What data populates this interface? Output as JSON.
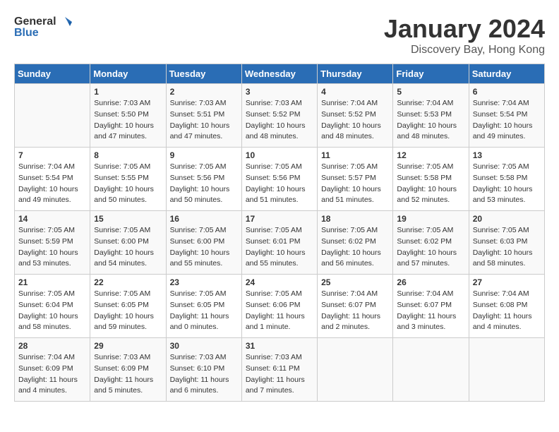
{
  "header": {
    "logo_line1": "General",
    "logo_line2": "Blue",
    "month_title": "January 2024",
    "location": "Discovery Bay, Hong Kong"
  },
  "days_of_week": [
    "Sunday",
    "Monday",
    "Tuesday",
    "Wednesday",
    "Thursday",
    "Friday",
    "Saturday"
  ],
  "weeks": [
    [
      {
        "day": "",
        "sunrise": "",
        "sunset": "",
        "daylight": ""
      },
      {
        "day": "1",
        "sunrise": "Sunrise: 7:03 AM",
        "sunset": "Sunset: 5:50 PM",
        "daylight": "Daylight: 10 hours and 47 minutes."
      },
      {
        "day": "2",
        "sunrise": "Sunrise: 7:03 AM",
        "sunset": "Sunset: 5:51 PM",
        "daylight": "Daylight: 10 hours and 47 minutes."
      },
      {
        "day": "3",
        "sunrise": "Sunrise: 7:03 AM",
        "sunset": "Sunset: 5:52 PM",
        "daylight": "Daylight: 10 hours and 48 minutes."
      },
      {
        "day": "4",
        "sunrise": "Sunrise: 7:04 AM",
        "sunset": "Sunset: 5:52 PM",
        "daylight": "Daylight: 10 hours and 48 minutes."
      },
      {
        "day": "5",
        "sunrise": "Sunrise: 7:04 AM",
        "sunset": "Sunset: 5:53 PM",
        "daylight": "Daylight: 10 hours and 48 minutes."
      },
      {
        "day": "6",
        "sunrise": "Sunrise: 7:04 AM",
        "sunset": "Sunset: 5:54 PM",
        "daylight": "Daylight: 10 hours and 49 minutes."
      }
    ],
    [
      {
        "day": "7",
        "sunrise": "Sunrise: 7:04 AM",
        "sunset": "Sunset: 5:54 PM",
        "daylight": "Daylight: 10 hours and 49 minutes."
      },
      {
        "day": "8",
        "sunrise": "Sunrise: 7:05 AM",
        "sunset": "Sunset: 5:55 PM",
        "daylight": "Daylight: 10 hours and 50 minutes."
      },
      {
        "day": "9",
        "sunrise": "Sunrise: 7:05 AM",
        "sunset": "Sunset: 5:56 PM",
        "daylight": "Daylight: 10 hours and 50 minutes."
      },
      {
        "day": "10",
        "sunrise": "Sunrise: 7:05 AM",
        "sunset": "Sunset: 5:56 PM",
        "daylight": "Daylight: 10 hours and 51 minutes."
      },
      {
        "day": "11",
        "sunrise": "Sunrise: 7:05 AM",
        "sunset": "Sunset: 5:57 PM",
        "daylight": "Daylight: 10 hours and 51 minutes."
      },
      {
        "day": "12",
        "sunrise": "Sunrise: 7:05 AM",
        "sunset": "Sunset: 5:58 PM",
        "daylight": "Daylight: 10 hours and 52 minutes."
      },
      {
        "day": "13",
        "sunrise": "Sunrise: 7:05 AM",
        "sunset": "Sunset: 5:58 PM",
        "daylight": "Daylight: 10 hours and 53 minutes."
      }
    ],
    [
      {
        "day": "14",
        "sunrise": "Sunrise: 7:05 AM",
        "sunset": "Sunset: 5:59 PM",
        "daylight": "Daylight: 10 hours and 53 minutes."
      },
      {
        "day": "15",
        "sunrise": "Sunrise: 7:05 AM",
        "sunset": "Sunset: 6:00 PM",
        "daylight": "Daylight: 10 hours and 54 minutes."
      },
      {
        "day": "16",
        "sunrise": "Sunrise: 7:05 AM",
        "sunset": "Sunset: 6:00 PM",
        "daylight": "Daylight: 10 hours and 55 minutes."
      },
      {
        "day": "17",
        "sunrise": "Sunrise: 7:05 AM",
        "sunset": "Sunset: 6:01 PM",
        "daylight": "Daylight: 10 hours and 55 minutes."
      },
      {
        "day": "18",
        "sunrise": "Sunrise: 7:05 AM",
        "sunset": "Sunset: 6:02 PM",
        "daylight": "Daylight: 10 hours and 56 minutes."
      },
      {
        "day": "19",
        "sunrise": "Sunrise: 7:05 AM",
        "sunset": "Sunset: 6:02 PM",
        "daylight": "Daylight: 10 hours and 57 minutes."
      },
      {
        "day": "20",
        "sunrise": "Sunrise: 7:05 AM",
        "sunset": "Sunset: 6:03 PM",
        "daylight": "Daylight: 10 hours and 58 minutes."
      }
    ],
    [
      {
        "day": "21",
        "sunrise": "Sunrise: 7:05 AM",
        "sunset": "Sunset: 6:04 PM",
        "daylight": "Daylight: 10 hours and 58 minutes."
      },
      {
        "day": "22",
        "sunrise": "Sunrise: 7:05 AM",
        "sunset": "Sunset: 6:05 PM",
        "daylight": "Daylight: 10 hours and 59 minutes."
      },
      {
        "day": "23",
        "sunrise": "Sunrise: 7:05 AM",
        "sunset": "Sunset: 6:05 PM",
        "daylight": "Daylight: 11 hours and 0 minutes."
      },
      {
        "day": "24",
        "sunrise": "Sunrise: 7:05 AM",
        "sunset": "Sunset: 6:06 PM",
        "daylight": "Daylight: 11 hours and 1 minute."
      },
      {
        "day": "25",
        "sunrise": "Sunrise: 7:04 AM",
        "sunset": "Sunset: 6:07 PM",
        "daylight": "Daylight: 11 hours and 2 minutes."
      },
      {
        "day": "26",
        "sunrise": "Sunrise: 7:04 AM",
        "sunset": "Sunset: 6:07 PM",
        "daylight": "Daylight: 11 hours and 3 minutes."
      },
      {
        "day": "27",
        "sunrise": "Sunrise: 7:04 AM",
        "sunset": "Sunset: 6:08 PM",
        "daylight": "Daylight: 11 hours and 4 minutes."
      }
    ],
    [
      {
        "day": "28",
        "sunrise": "Sunrise: 7:04 AM",
        "sunset": "Sunset: 6:09 PM",
        "daylight": "Daylight: 11 hours and 4 minutes."
      },
      {
        "day": "29",
        "sunrise": "Sunrise: 7:03 AM",
        "sunset": "Sunset: 6:09 PM",
        "daylight": "Daylight: 11 hours and 5 minutes."
      },
      {
        "day": "30",
        "sunrise": "Sunrise: 7:03 AM",
        "sunset": "Sunset: 6:10 PM",
        "daylight": "Daylight: 11 hours and 6 minutes."
      },
      {
        "day": "31",
        "sunrise": "Sunrise: 7:03 AM",
        "sunset": "Sunset: 6:11 PM",
        "daylight": "Daylight: 11 hours and 7 minutes."
      },
      {
        "day": "",
        "sunrise": "",
        "sunset": "",
        "daylight": ""
      },
      {
        "day": "",
        "sunrise": "",
        "sunset": "",
        "daylight": ""
      },
      {
        "day": "",
        "sunrise": "",
        "sunset": "",
        "daylight": ""
      }
    ]
  ]
}
